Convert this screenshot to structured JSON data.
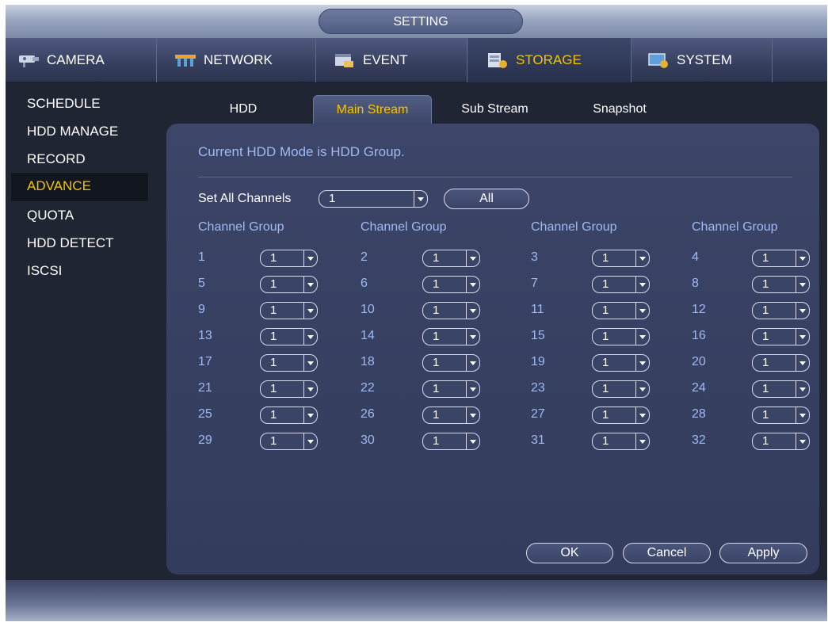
{
  "window": {
    "title": "SETTING"
  },
  "main_tabs": [
    {
      "label": "CAMERA",
      "icon": "camera-icon"
    },
    {
      "label": "NETWORK",
      "icon": "network-icon"
    },
    {
      "label": "EVENT",
      "icon": "event-icon"
    },
    {
      "label": "STORAGE",
      "icon": "storage-icon"
    },
    {
      "label": "SYSTEM",
      "icon": "system-icon"
    }
  ],
  "active_main_tab": "STORAGE",
  "side_menu": [
    {
      "label": "SCHEDULE"
    },
    {
      "label": "HDD MANAGE"
    },
    {
      "label": "RECORD"
    },
    {
      "label": "ADVANCE"
    },
    {
      "label": "QUOTA"
    },
    {
      "label": "HDD DETECT"
    },
    {
      "label": "ISCSI"
    }
  ],
  "active_side_item": "ADVANCE",
  "sub_tabs": [
    {
      "label": "HDD"
    },
    {
      "label": "Main Stream"
    },
    {
      "label": "Sub Stream"
    },
    {
      "label": "Snapshot"
    }
  ],
  "active_sub_tab": "Main Stream",
  "info_text": "Current HDD Mode is HDD Group.",
  "set_all": {
    "label": "Set All Channels",
    "value": "1",
    "button": "All"
  },
  "column_header": {
    "channel": "Channel",
    "group": "Group"
  },
  "channels": [
    {
      "ch": "1",
      "group": "1"
    },
    {
      "ch": "2",
      "group": "1"
    },
    {
      "ch": "3",
      "group": "1"
    },
    {
      "ch": "4",
      "group": "1"
    },
    {
      "ch": "5",
      "group": "1"
    },
    {
      "ch": "6",
      "group": "1"
    },
    {
      "ch": "7",
      "group": "1"
    },
    {
      "ch": "8",
      "group": "1"
    },
    {
      "ch": "9",
      "group": "1"
    },
    {
      "ch": "10",
      "group": "1"
    },
    {
      "ch": "11",
      "group": "1"
    },
    {
      "ch": "12",
      "group": "1"
    },
    {
      "ch": "13",
      "group": "1"
    },
    {
      "ch": "14",
      "group": "1"
    },
    {
      "ch": "15",
      "group": "1"
    },
    {
      "ch": "16",
      "group": "1"
    },
    {
      "ch": "17",
      "group": "1"
    },
    {
      "ch": "18",
      "group": "1"
    },
    {
      "ch": "19",
      "group": "1"
    },
    {
      "ch": "20",
      "group": "1"
    },
    {
      "ch": "21",
      "group": "1"
    },
    {
      "ch": "22",
      "group": "1"
    },
    {
      "ch": "23",
      "group": "1"
    },
    {
      "ch": "24",
      "group": "1"
    },
    {
      "ch": "25",
      "group": "1"
    },
    {
      "ch": "26",
      "group": "1"
    },
    {
      "ch": "27",
      "group": "1"
    },
    {
      "ch": "28",
      "group": "1"
    },
    {
      "ch": "29",
      "group": "1"
    },
    {
      "ch": "30",
      "group": "1"
    },
    {
      "ch": "31",
      "group": "1"
    },
    {
      "ch": "32",
      "group": "1"
    }
  ],
  "buttons": {
    "ok": "OK",
    "cancel": "Cancel",
    "apply": "Apply"
  },
  "colors": {
    "accent": "#f5c400",
    "label_blue": "#9fbaf2",
    "panel": "#394264"
  }
}
